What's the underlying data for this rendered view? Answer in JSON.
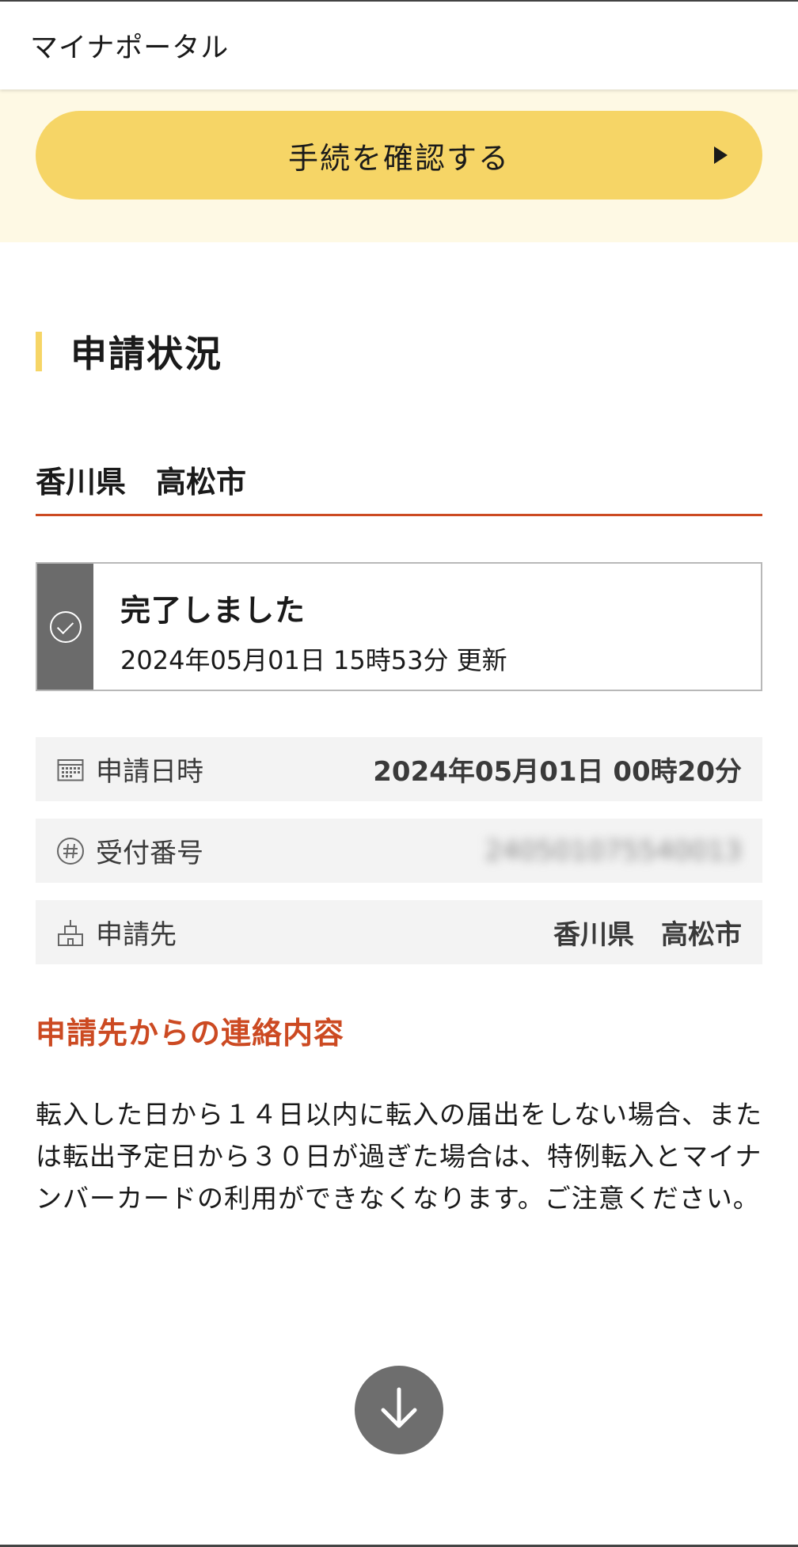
{
  "header": {
    "title": "マイナポータル"
  },
  "action": {
    "confirm_label": "手続を確認する"
  },
  "section": {
    "heading": "申請状況"
  },
  "municipality": "香川県　高松市",
  "status": {
    "title": "完了しました",
    "updated": "2024年05月01日 15時53分 更新"
  },
  "details": [
    {
      "label": "申請日時",
      "value": "2024年05月01日 00時20分",
      "icon": "calendar-icon"
    },
    {
      "label": "受付番号",
      "value": "240501075540013",
      "icon": "hash-icon"
    },
    {
      "label": "申請先",
      "value": "香川県　高松市",
      "icon": "building-icon"
    }
  ],
  "contact": {
    "heading": "申請先からの連絡内容",
    "body": "転入した日から１４日以内に転入の届出をしない場合、または転出予定日から３０日が過ぎた場合は、特例転入とマイナンバーカードの利用ができなくなります。ご注意ください。"
  },
  "colors": {
    "accent_yellow": "#f6d566",
    "band_yellow": "#fef9e4",
    "accent_red": "#cc4a22",
    "status_gray": "#6b6b6b"
  }
}
